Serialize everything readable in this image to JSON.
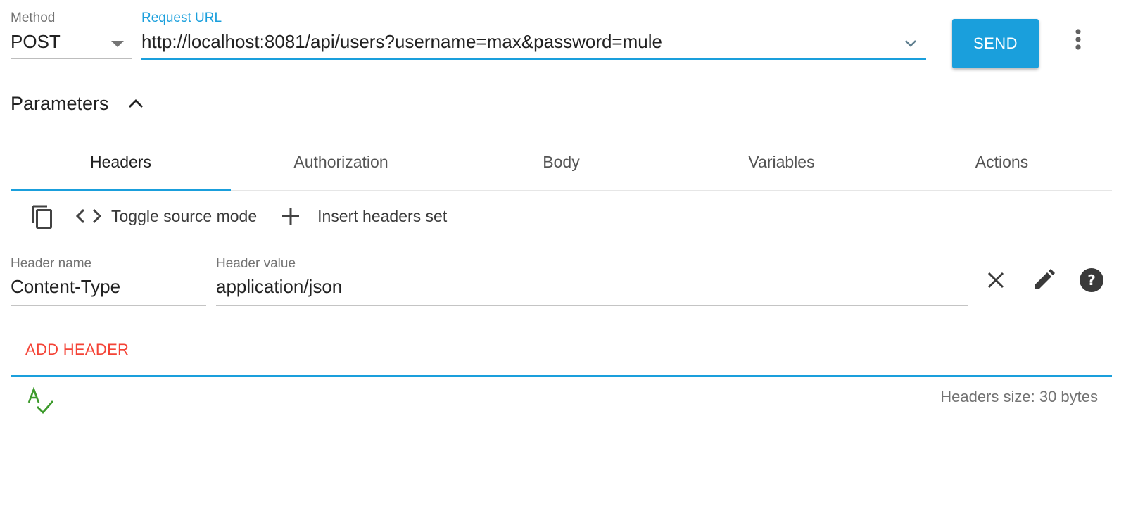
{
  "request": {
    "method_label": "Method",
    "method_value": "POST",
    "url_label": "Request URL",
    "url_value": "http://localhost:8081/api/users?username=max&password=mule",
    "send_label": "SEND"
  },
  "parameters": {
    "title": "Parameters"
  },
  "tabs": [
    {
      "label": "Headers",
      "active": true
    },
    {
      "label": "Authorization",
      "active": false
    },
    {
      "label": "Body",
      "active": false
    },
    {
      "label": "Variables",
      "active": false
    },
    {
      "label": "Actions",
      "active": false
    }
  ],
  "toolbar": {
    "toggle_source_label": "Toggle source mode",
    "insert_headers_label": "Insert headers set"
  },
  "header_row": {
    "name_label": "Header name",
    "name_value": "Content-Type",
    "value_label": "Header value",
    "value_value": "application/json"
  },
  "add_header_label": "ADD HEADER",
  "headers_size": "Headers size: 30 bytes",
  "icons": {
    "method": "chevron-down-icon",
    "url": "expand-more-icon",
    "more": "more-vert-icon",
    "params": "expand-less-icon",
    "copy": "copy-icon",
    "code": "code-icon",
    "add": "add-icon",
    "remove": "close-icon",
    "edit": "edit-icon",
    "help": "help-icon",
    "spellcheck": "spellcheck-icon"
  },
  "colors": {
    "accent": "#1a9fdc",
    "danger": "#f44336",
    "success": "#3c9a2b"
  }
}
